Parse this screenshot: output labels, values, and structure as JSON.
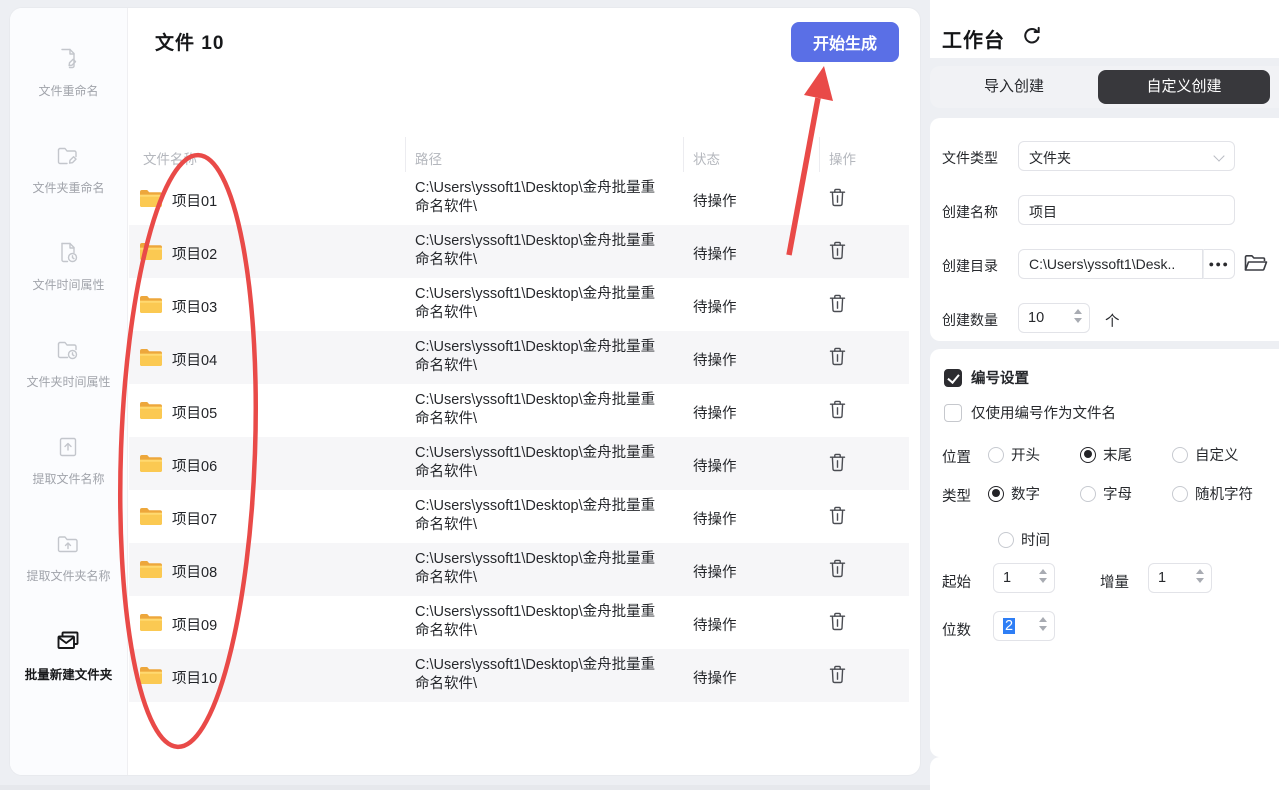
{
  "sidebar": {
    "items": [
      {
        "label": "文件重命名",
        "icon": "file-rename-icon",
        "active": false
      },
      {
        "label": "文件夹重命名",
        "icon": "folder-rename-icon",
        "active": false
      },
      {
        "label": "文件时间属性",
        "icon": "file-time-icon",
        "active": false
      },
      {
        "label": "文件夹时间属性",
        "icon": "folder-time-icon",
        "active": false
      },
      {
        "label": "提取文件名称",
        "icon": "extract-file-name-icon",
        "active": false
      },
      {
        "label": "提取文件夹名称",
        "icon": "extract-folder-name-icon",
        "active": false
      },
      {
        "label": "批量新建文件夹",
        "icon": "batch-new-folder-icon",
        "active": true
      }
    ]
  },
  "main": {
    "title": "文件",
    "count": "10",
    "generate_button": "开始生成",
    "table": {
      "columns": [
        "文件名称",
        "路径",
        "状态",
        "操作"
      ],
      "row_icons": {
        "folder": "folder-icon",
        "delete": "trash-icon"
      },
      "rows": [
        {
          "name": "项目01",
          "path": "C:\\Users\\yssoft1\\Desktop\\金舟批量重命名软件\\",
          "status": "待操作"
        },
        {
          "name": "项目02",
          "path": "C:\\Users\\yssoft1\\Desktop\\金舟批量重命名软件\\",
          "status": "待操作"
        },
        {
          "name": "项目03",
          "path": "C:\\Users\\yssoft1\\Desktop\\金舟批量重命名软件\\",
          "status": "待操作"
        },
        {
          "name": "项目04",
          "path": "C:\\Users\\yssoft1\\Desktop\\金舟批量重命名软件\\",
          "status": "待操作"
        },
        {
          "name": "项目05",
          "path": "C:\\Users\\yssoft1\\Desktop\\金舟批量重命名软件\\",
          "status": "待操作"
        },
        {
          "name": "项目06",
          "path": "C:\\Users\\yssoft1\\Desktop\\金舟批量重命名软件\\",
          "status": "待操作"
        },
        {
          "name": "项目07",
          "path": "C:\\Users\\yssoft1\\Desktop\\金舟批量重命名软件\\",
          "status": "待操作"
        },
        {
          "name": "项目08",
          "path": "C:\\Users\\yssoft1\\Desktop\\金舟批量重命名软件\\",
          "status": "待操作"
        },
        {
          "name": "项目09",
          "path": "C:\\Users\\yssoft1\\Desktop\\金舟批量重命名软件\\",
          "status": "待操作"
        },
        {
          "name": "项目10",
          "path": "C:\\Users\\yssoft1\\Desktop\\金舟批量重命名软件\\",
          "status": "待操作"
        }
      ]
    }
  },
  "workbench": {
    "title": "工作台",
    "refresh_icon": "refresh-icon",
    "tabs": [
      {
        "label": "导入创建",
        "active": false
      },
      {
        "label": "自定义创建",
        "active": true
      }
    ],
    "fields": {
      "file_type": {
        "label": "文件类型",
        "value": "文件夹"
      },
      "create_name": {
        "label": "创建名称",
        "value": "项目"
      },
      "create_dir": {
        "label": "创建目录",
        "value": "C:\\Users\\yssoft1\\Desk..",
        "more_button": "●●●",
        "browse_icon": "folder-open-icon"
      },
      "create_count": {
        "label": "创建数量",
        "value": "10",
        "unit": "个"
      }
    },
    "numbering": {
      "enable": {
        "label": "编号设置",
        "checked": true
      },
      "only_number": {
        "label": "仅使用编号作为文件名",
        "checked": false
      },
      "position": {
        "label": "位置",
        "options": [
          "开头",
          "末尾",
          "自定义"
        ],
        "selected": "末尾"
      },
      "type": {
        "label": "类型",
        "options": [
          "数字",
          "字母",
          "随机字符",
          "时间"
        ],
        "selected": "数字"
      },
      "start": {
        "label": "起始",
        "value": "1"
      },
      "increment": {
        "label": "增量",
        "value": "1"
      },
      "digits": {
        "label": "位数",
        "value": "2"
      }
    }
  },
  "annotations": {
    "ellipse_color": "#e94a48",
    "arrow_color": "#e94a48",
    "button_color": "#5a6fe6",
    "active_tab_color": "#38383c"
  }
}
